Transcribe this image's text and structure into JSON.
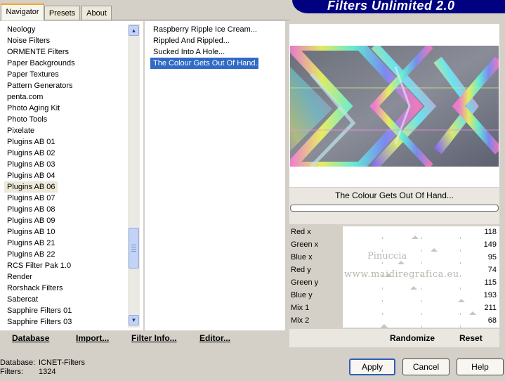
{
  "tabs": [
    "Navigator",
    "Presets",
    "About"
  ],
  "banner_title": "Filters Unlimited 2.0",
  "categories": [
    "Neology",
    "Noise Filters",
    "ORMENTE Filters",
    "Paper Backgrounds",
    "Paper Textures",
    "Pattern Generators",
    "penta.com",
    "Photo Aging Kit",
    "Photo Tools",
    "Pixelate",
    "Plugins AB 01",
    "Plugins AB 02",
    "Plugins AB 03",
    "Plugins AB 04",
    "Plugins AB 06",
    "Plugins AB 07",
    "Plugins AB 08",
    "Plugins AB 09",
    "Plugins AB 10",
    "Plugins AB 21",
    "Plugins AB 22",
    "RCS Filter Pak 1.0",
    "Render",
    "Rorshack Filters",
    "Sabercat",
    "Sapphire Filters 01",
    "Sapphire Filters 03"
  ],
  "selected_category": "Plugins AB 06",
  "filters": [
    "Raspberry Ripple Ice Cream...",
    "Rippled And Rippled...",
    "Sucked Into A Hole...",
    "The Colour Gets Out Of Hand..."
  ],
  "selected_filter": "The Colour Gets Out Of Hand...",
  "bottom_links": {
    "database": "Database",
    "import": "Import...",
    "filter_info": "Filter Info...",
    "editor": "Editor..."
  },
  "preview_title": "The Colour Gets Out Of Hand...",
  "params": [
    {
      "label": "Red x",
      "value": "118",
      "level": 118
    },
    {
      "label": "Green x",
      "value": "149",
      "level": 149
    },
    {
      "label": "Blue x",
      "value": "95",
      "level": 95
    },
    {
      "label": "Red y",
      "value": "74",
      "level": 74
    },
    {
      "label": "Green y",
      "value": "115",
      "level": 115
    },
    {
      "label": "Blue y",
      "value": "193",
      "level": 193
    },
    {
      "label": "Mix 1",
      "value": "211",
      "level": 211
    },
    {
      "label": "Mix 2",
      "value": "68",
      "level": 68
    }
  ],
  "watermark": {
    "line1": "Pinuccia",
    "line2": "www.maidiregrafica.eu"
  },
  "right_links": {
    "randomize": "Randomize",
    "reset": "Reset"
  },
  "status": {
    "database_label": "Database:",
    "database_value": "ICNET-Filters",
    "filters_label": "Filters:",
    "filters_value": "1324"
  },
  "buttons": {
    "apply": "Apply",
    "cancel": "Cancel",
    "help": "Help"
  },
  "colors": {
    "banner": "#000080",
    "selection": "#316ac5",
    "tab_accent": "#f5a623"
  }
}
